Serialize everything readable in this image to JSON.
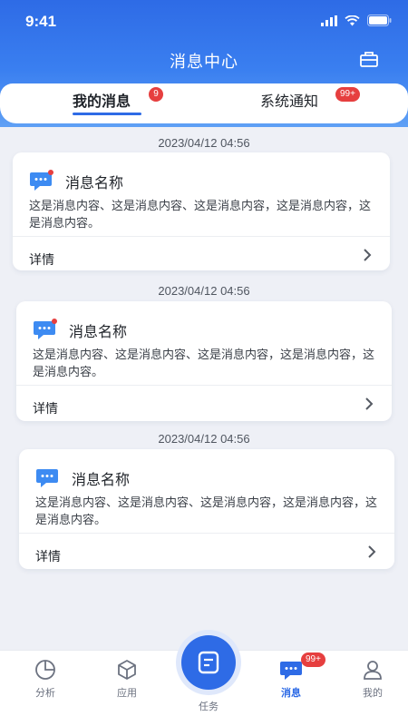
{
  "status": {
    "time": "9:41"
  },
  "nav": {
    "title": "消息中心",
    "action_icon": "toolbox-icon"
  },
  "tabs": [
    {
      "label": "我的消息",
      "badge": "9",
      "active": true
    },
    {
      "label": "系统通知",
      "badge": "99+",
      "active": false
    }
  ],
  "messages": [
    {
      "time": "2023/04/12 04:56",
      "title": "消息名称",
      "body": "这是消息内容、这是消息内容、这是消息内容，这是消息内容，这是消息内容。",
      "detail": "详情",
      "unread": true
    },
    {
      "time": "2023/04/12 04:56",
      "title": "消息名称",
      "body": "这是消息内容、这是消息内容、这是消息内容，这是消息内容，这是消息内容。",
      "detail": "详情",
      "unread": true
    },
    {
      "time": "2023/04/12 04:56",
      "title": "消息名称",
      "body": "这是消息内容、这是消息内容、这是消息内容，这是消息内容，这是消息内容。",
      "detail": "详情",
      "unread": false
    }
  ],
  "tabbar": {
    "items": [
      {
        "label": "分析",
        "icon": "pie-chart-icon"
      },
      {
        "label": "应用",
        "icon": "cube-icon"
      },
      {
        "label": "任务",
        "icon": "task-icon"
      },
      {
        "label": "消息",
        "icon": "chat-icon",
        "badge": "99+",
        "active": true
      },
      {
        "label": "我的",
        "icon": "user-icon"
      }
    ]
  },
  "colors": {
    "primary": "#2e6be6",
    "badge": "#e63f3f",
    "background": "#eef0f6"
  }
}
